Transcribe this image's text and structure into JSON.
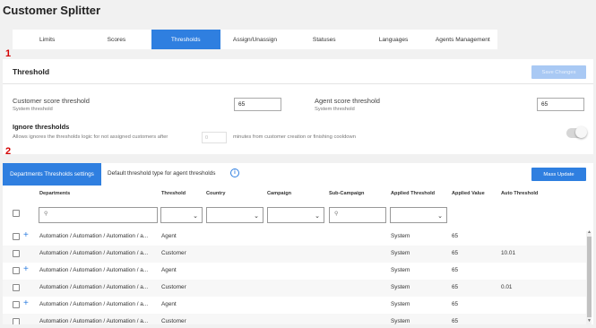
{
  "app": {
    "title": "Customer Splitter"
  },
  "tabs": [
    {
      "label": "Limits"
    },
    {
      "label": "Scores"
    },
    {
      "label": "Thresholds",
      "active": true
    },
    {
      "label": "Assign/Unassign"
    },
    {
      "label": "Statuses"
    },
    {
      "label": "Languages"
    },
    {
      "label": "Agents Management"
    }
  ],
  "markers": {
    "one": "1",
    "two": "2"
  },
  "threshold": {
    "title": "Threshold",
    "save_label": "Save Changes",
    "customer_label": "Customer score threshold",
    "customer_sub": "System threshold",
    "customer_value": "65",
    "agent_label": "Agent score threshold",
    "agent_sub": "System threshold",
    "agent_value": "65",
    "ignore_title": "Ignore thresholds",
    "ignore_desc_before": "Allows ignores the thresholds logic for not assigned customers after",
    "ignore_input_value": "0",
    "ignore_desc_after": "minutes from customer creation or finishing cooldown",
    "toggle_on": false
  },
  "departments": {
    "tab_label": "Departments Thresholds settings",
    "default_text": "Default threshold type for agent thresholds",
    "info_icon": "i",
    "mass_update_label": "Mass Update",
    "columns": [
      "Departments",
      "Threshold",
      "Country",
      "Campaign",
      "Sub-Campaign",
      "Applied Threshold",
      "Applied Value",
      "Auto Threshold"
    ],
    "rows": [
      {
        "expand": true,
        "department": "Automation / Automation / Automation / a...",
        "threshold": "Agent",
        "applied": "System",
        "value": "65",
        "auto": ""
      },
      {
        "expand": false,
        "department": "Automation / Automation / Automation / a...",
        "threshold": "Customer",
        "applied": "System",
        "value": "65",
        "auto": "10.01"
      },
      {
        "expand": true,
        "department": "Automation / Automation / Automation / a...",
        "threshold": "Agent",
        "applied": "System",
        "value": "65",
        "auto": ""
      },
      {
        "expand": false,
        "department": "Automation / Automation / Automation / a...",
        "threshold": "Customer",
        "applied": "System",
        "value": "65",
        "auto": "0.01"
      },
      {
        "expand": true,
        "department": "Automation / Automation / Automation / a...",
        "threshold": "Agent",
        "applied": "System",
        "value": "65",
        "auto": ""
      },
      {
        "expand": false,
        "department": "Automation / Automation / Automation / a...",
        "threshold": "Customer",
        "applied": "System",
        "value": "65",
        "auto": ""
      }
    ]
  },
  "colors": {
    "accent": "#2f7fe0",
    "marker": "#d40000",
    "disabled_button": "#a9c9f4"
  }
}
